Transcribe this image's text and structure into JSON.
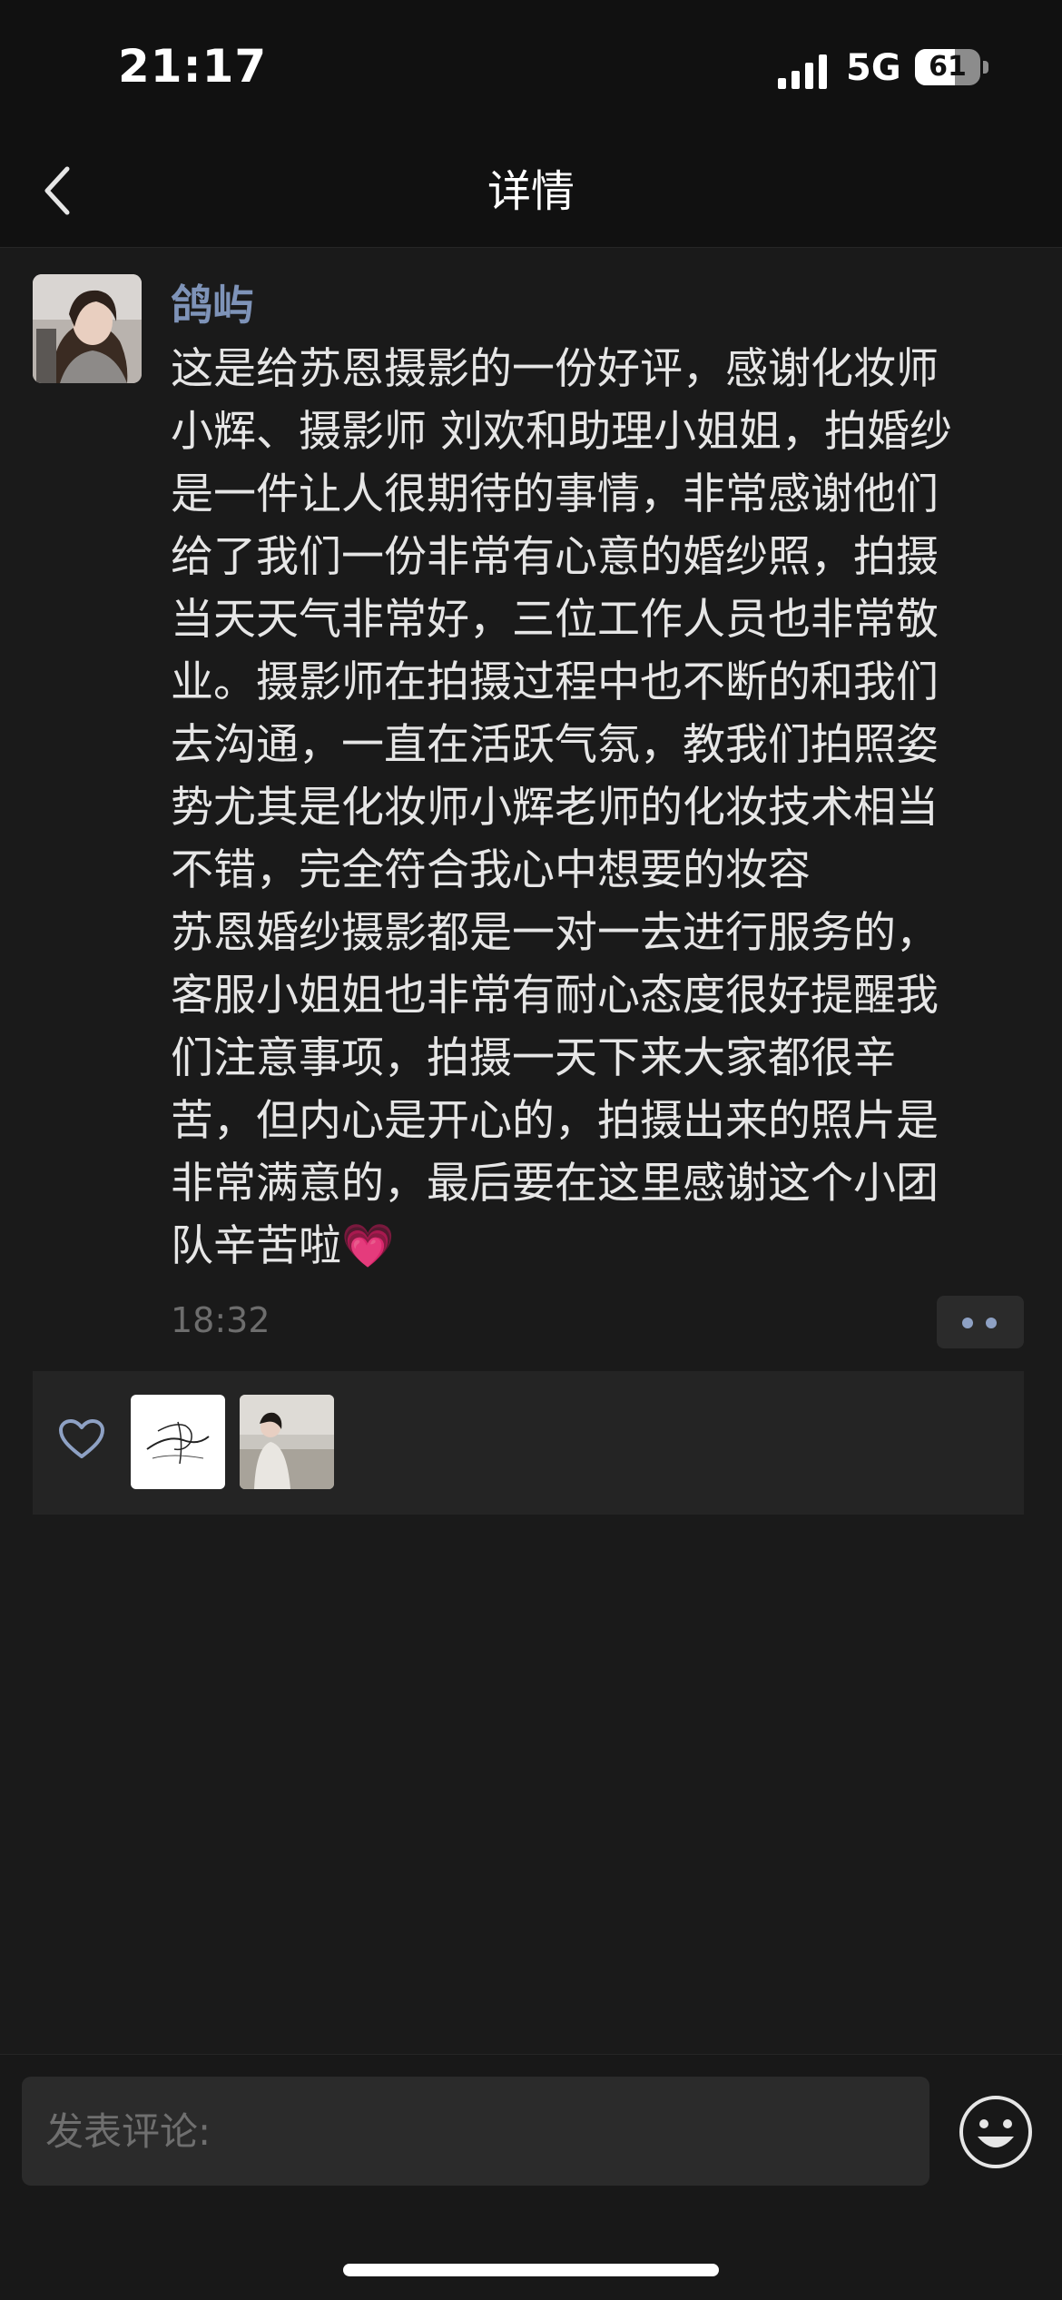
{
  "status_bar": {
    "time": "21:17",
    "network": "5G",
    "battery": "61",
    "battery_level": 0.61
  },
  "nav": {
    "title": "详情",
    "back_icon": "chevron-left-icon"
  },
  "post": {
    "username": "鸽屿",
    "text": "这是给苏恩摄影的一份好评，感谢化妆师\n小辉、摄影师 刘欢和助理小姐姐，拍婚纱\n是一件让人很期待的事情，非常感谢他们\n给了我们一份非常有心意的婚纱照，拍摄\n当天天气非常好，三位工作人员也非常敬\n业。摄影师在拍摄过程中也不断的和我们\n去沟通，一直在活跃气氛，教我们拍照姿\n势尤其是化妆师小辉老师的化妆技术相当\n不错，完全符合我心中想要的妆容\n苏恩婚纱摄影都是一对一去进行服务的，\n客服小姐姐也非常有耐心态度很好提醒我\n们注意事项，拍摄一天下来大家都很辛\n苦，但内心是开心的，拍摄出来的照片是\n非常满意的，最后要在这里感谢这个小团\n队辛苦啦💗",
    "time": "18:32",
    "more_icon": "more-dots-icon",
    "likes_icon": "heart-outline-icon",
    "likers": [
      {
        "name": "liker-avatar-sketch"
      },
      {
        "name": "liker-avatar-beach"
      }
    ]
  },
  "comment": {
    "placeholder": "发表评论:",
    "emoji_icon": "smiley-face-icon"
  },
  "colors": {
    "background": "#1a1a1a",
    "username": "#7e93b8",
    "text": "#e6e6e6",
    "muted": "#6d6d6d"
  }
}
